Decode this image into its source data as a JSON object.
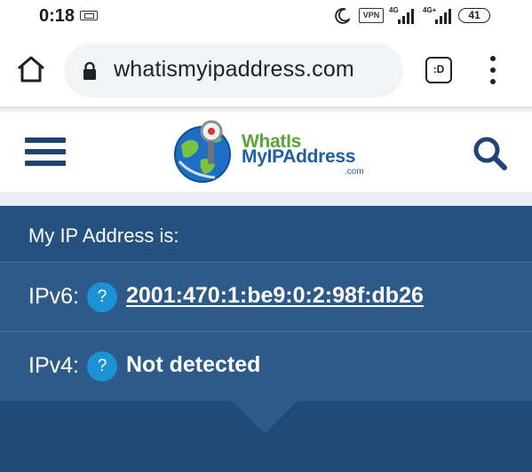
{
  "status_bar": {
    "time": "0:18",
    "vpn_label": "VPN",
    "signal1_label": "4G",
    "signal2_label": "4G+",
    "battery": "41"
  },
  "browser": {
    "url": "whatismyipaddress.com",
    "tab_label": ":D"
  },
  "site": {
    "logo_line1": "WhatIs",
    "logo_line2": "MyIPAddress",
    "logo_suffix": ".com"
  },
  "ip_panel": {
    "heading": "My IP Address is:",
    "rows": [
      {
        "label": "IPv6:",
        "help": "?",
        "value": "2001:470:1:be9:0:2:98f:db26"
      },
      {
        "label": "IPv4:",
        "help": "?",
        "value": "Not detected"
      }
    ]
  },
  "colors": {
    "panel_bg": "#2b5786",
    "header_blue": "#1f4474",
    "help_badge": "#1a92d4",
    "logo_green": "#5aa635",
    "logo_blue": "#1f5fa8"
  }
}
